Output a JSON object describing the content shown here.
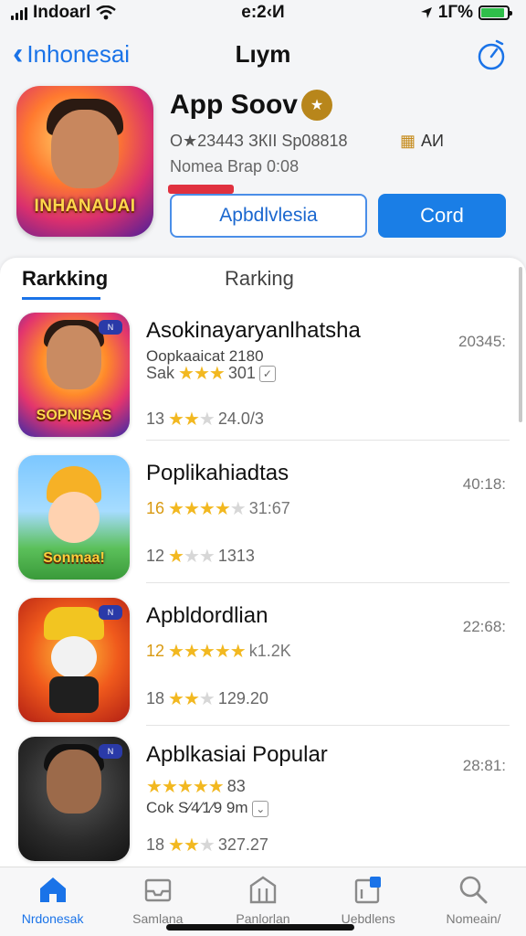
{
  "status": {
    "carrier": "Indoarl",
    "time": "e:2‹И",
    "battery": "1Г%",
    "battery_level": 0.9
  },
  "nav": {
    "back_label": "Inhonesai",
    "title": "Lıym"
  },
  "app": {
    "name": "App Soov",
    "meta1": "O★2344З ЗКII Sp08818",
    "meta_rank": "AИ",
    "meta2": "Nomea Brap 0:08",
    "btn_outline": "Apbdlvlesia",
    "btn_solid": "Cord",
    "icon_caption": "INHANAUAI"
  },
  "tabs": {
    "active": "Rarkking",
    "second": "Rarking"
  },
  "list": [
    {
      "title": "Asokinayaryanlhatsha",
      "line2": "Oopkaaicat 2180",
      "rating_prefix": "Sak",
      "rating_stars": 3,
      "rating_tail": "301",
      "line3_prefix": "13",
      "line3_stars": 2,
      "line3_tail": "24.0/3",
      "time": "20345:",
      "caption": "SOPNISAS"
    },
    {
      "title": "Poplikahiadtas",
      "rating_prefix": "16",
      "rating_stars": 4,
      "rating_tail": "31:67",
      "line3_prefix": "12",
      "line3_stars": 1,
      "line3_tail": "1313",
      "time": "40:18:",
      "caption": "Sonmaa!"
    },
    {
      "title": "Apbldordlian",
      "rating_prefix": "12",
      "rating_stars": 5,
      "rating_tail": "k1.2K",
      "line3_prefix": "18",
      "line3_stars": 2,
      "line3_tail": "129.20",
      "time": "22:68:",
      "caption": ""
    },
    {
      "title": "Apblkasiai Popular",
      "rating_prefix": "",
      "rating_stars": 5,
      "rating_tail": "83",
      "line2": "Cok S⁄4⁄1⁄9 9m",
      "line3_prefix": "18",
      "line3_stars": 2,
      "line3_tail": "327.27",
      "time": "28:81:",
      "caption": ""
    }
  ],
  "tabbar": [
    {
      "label": "Nrdonesak",
      "icon": "home-icon"
    },
    {
      "label": "Samlana",
      "icon": "inbox-icon"
    },
    {
      "label": "Panlorlan",
      "icon": "building-icon"
    },
    {
      "label": "Uebdlens",
      "icon": "updates-icon"
    },
    {
      "label": "Nomeain/",
      "icon": "search-icon"
    }
  ],
  "colors": {
    "accent": "#1a73e8",
    "gold": "#f2b820"
  }
}
